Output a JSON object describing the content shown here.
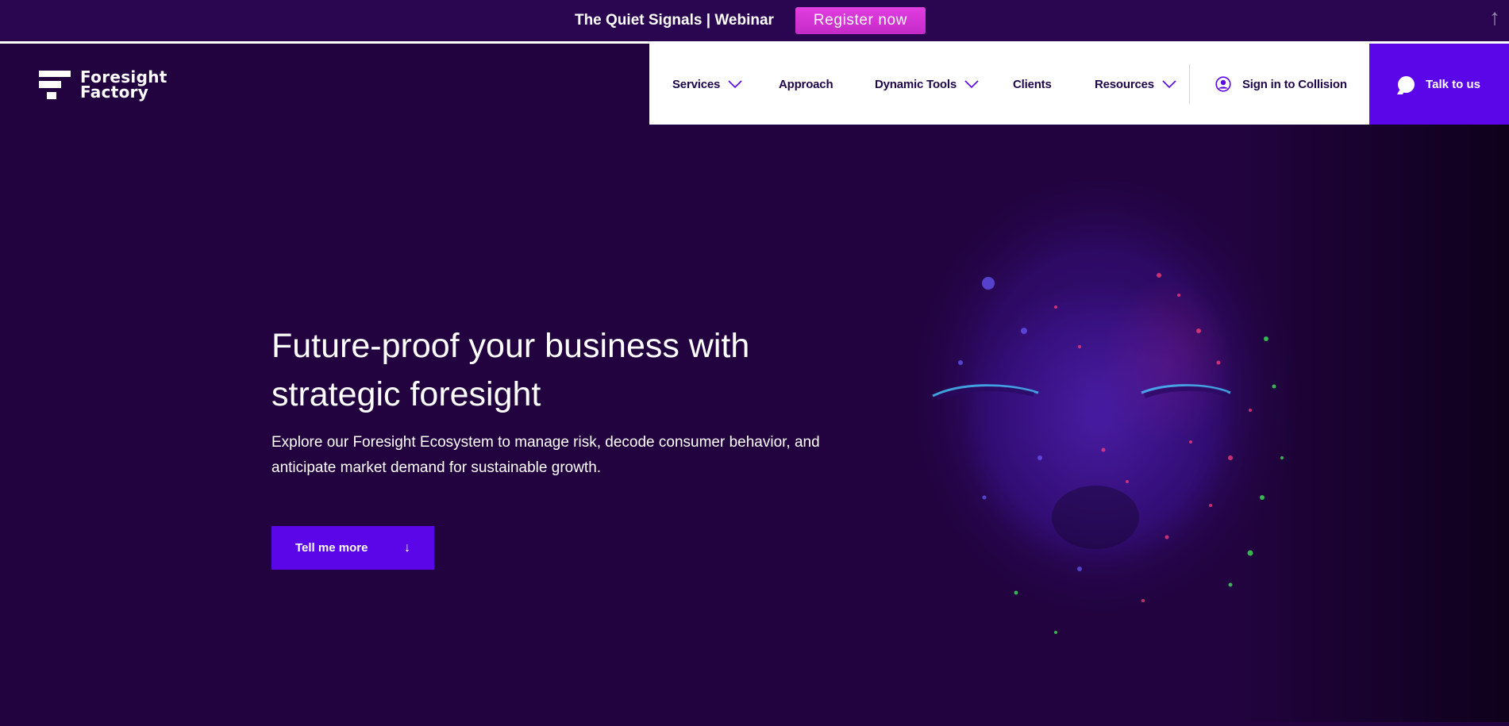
{
  "banner": {
    "title": "The Quiet Signals | Webinar",
    "register_label": "Register now",
    "scroll_icon": "arrow-up-icon"
  },
  "logo": {
    "line1": "Foresight",
    "line2": "Factory"
  },
  "nav": {
    "items": [
      {
        "label": "Services",
        "has_dropdown": true
      },
      {
        "label": "Approach",
        "has_dropdown": false
      },
      {
        "label": "Dynamic Tools",
        "has_dropdown": true
      },
      {
        "label": "Clients",
        "has_dropdown": false
      },
      {
        "label": "Resources",
        "has_dropdown": true
      }
    ],
    "sign_in_label": "Sign in to Collision",
    "talk_label": "Talk to us"
  },
  "hero": {
    "title": "Future-proof your business with strategic foresight",
    "subtitle": "Explore our Foresight Ecosystem to manage risk, decode consumer behavior, and anticipate market demand for sustainable growth.",
    "cta_label": "Tell me more",
    "cta_icon": "arrow-down-icon"
  },
  "colors": {
    "page_bg": "#22033f",
    "banner_bg": "#2a0650",
    "register_bg": "#d234d4",
    "accent": "#5a06e8",
    "nav_text": "#1f0749"
  }
}
